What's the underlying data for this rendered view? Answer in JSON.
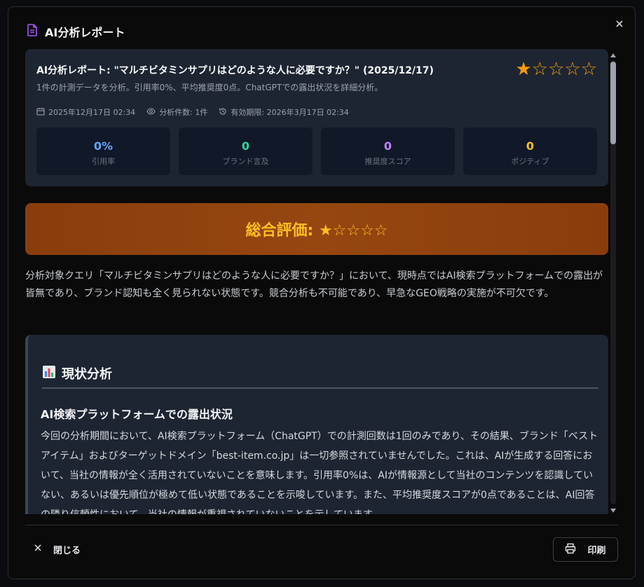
{
  "modal": {
    "title": "AI分析レポート"
  },
  "summary": {
    "title": "AI分析レポート: \"マルチビタミンサプリはどのような人に必要ですか？\" (2025/12/17)",
    "description": "1件の計測データを分析。引用率0%、平均推奨度0点。ChatGPTでの露出状況を詳細分析。",
    "rating_stars": "★☆☆☆☆",
    "meta": {
      "date": "2025年12月17日 02:34",
      "count": "分析件数: 1件",
      "expiry": "有効期限: 2026年3月17日 02:34"
    },
    "metrics": [
      {
        "value": "0%",
        "label": "引用率",
        "color": "#60a5fa"
      },
      {
        "value": "0",
        "label": "ブランド言及",
        "color": "#34d399"
      },
      {
        "value": "0",
        "label": "推奨度スコア",
        "color": "#c084fc"
      },
      {
        "value": "0",
        "label": "ポジティブ",
        "color": "#fbbf24"
      }
    ]
  },
  "overall": {
    "text": "総合評価: ★☆☆☆☆"
  },
  "intro": "分析対象クエリ「マルチビタミンサプリはどのような人に必要ですか？」において、現時点ではAI検索プラットフォームでの露出が皆無であり、ブランド認知も全く見られない状態です。競合分析も不可能であり、早急なGEO戦略の実施が不可欠です。",
  "analysis": {
    "heading": "現状分析",
    "subheading": "AI検索プラットフォームでの露出状況",
    "body": "今回の分析期間において、AI検索プラットフォーム（ChatGPT）での計測回数は1回のみであり、その結果、ブランド「ベストアイテム」およびターゲットドメイン「best-item.co.jp」は一切参照されていませんでした。これは、AIが生成する回答において、当社の情報が全く活用されていないことを意味します。引用率0%は、AIが情報源として当社のコンテンツを認識していない、あるいは優先順位が極めて低い状態であることを示唆しています。また、平均推奨度スコアが0点であることは、AI回答の隣り信頼性において、当社の情報が重視されていないことを示しています。"
  },
  "footer": {
    "close_label": "閉じる",
    "print_label": "印刷"
  }
}
